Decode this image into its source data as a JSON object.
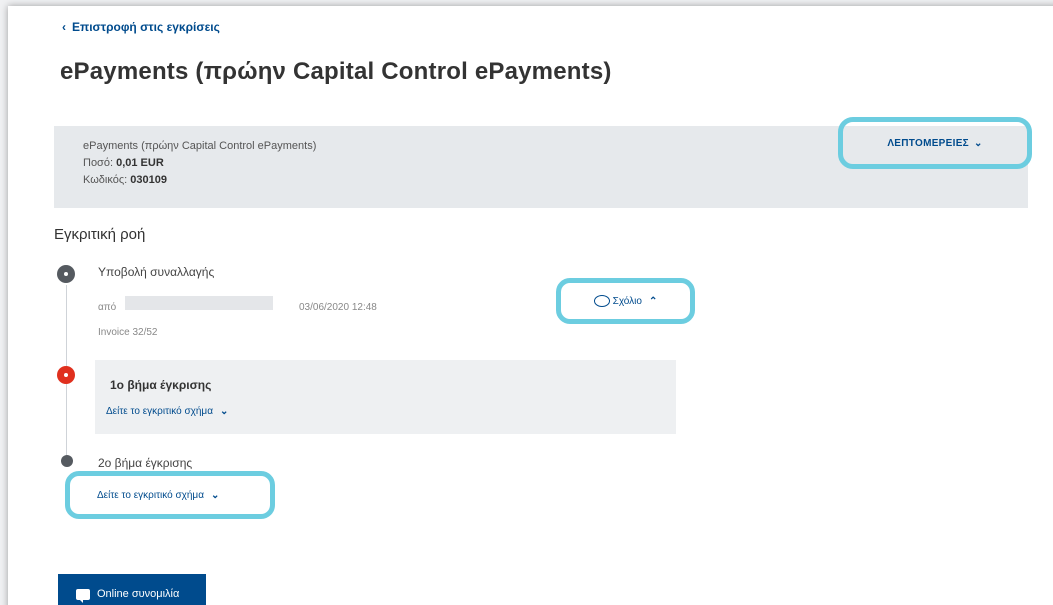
{
  "nav": {
    "back_label": "Επιστροφή στις εγκρίσεις"
  },
  "page": {
    "title": "ePayments (πρώην Capital Control ePayments)"
  },
  "summary": {
    "name": "ePayments (πρώην Capital Control ePayments)",
    "amount_label": "Ποσό:",
    "amount_value": "0,01 EUR",
    "code_label": "Κωδικός:",
    "code_value": "030109",
    "details_label": "ΛΕΠΤΟΜΕΡΕΙΕΣ"
  },
  "flow": {
    "title": "Εγκριτική ροή",
    "submission": {
      "title": "Υποβολή συναλλαγής",
      "from_label": "από",
      "datetime": "03/06/2020 12:48",
      "note": "Invoice 32/52",
      "comment_label": "Σχόλιο"
    },
    "step1": {
      "title": "1ο βήμα έγκρισης",
      "link": "Δείτε το εγκριτικό σχήμα"
    },
    "step2": {
      "title": "2ο βήμα έγκρισης",
      "link": "Δείτε το εγκριτικό σχήμα"
    }
  },
  "chat": {
    "label": "Online συνομιλία"
  },
  "colors": {
    "brand_blue": "#004b8d",
    "highlight": "#6ccde0",
    "active_step": "#e0301e",
    "inactive_step": "#555a60"
  }
}
